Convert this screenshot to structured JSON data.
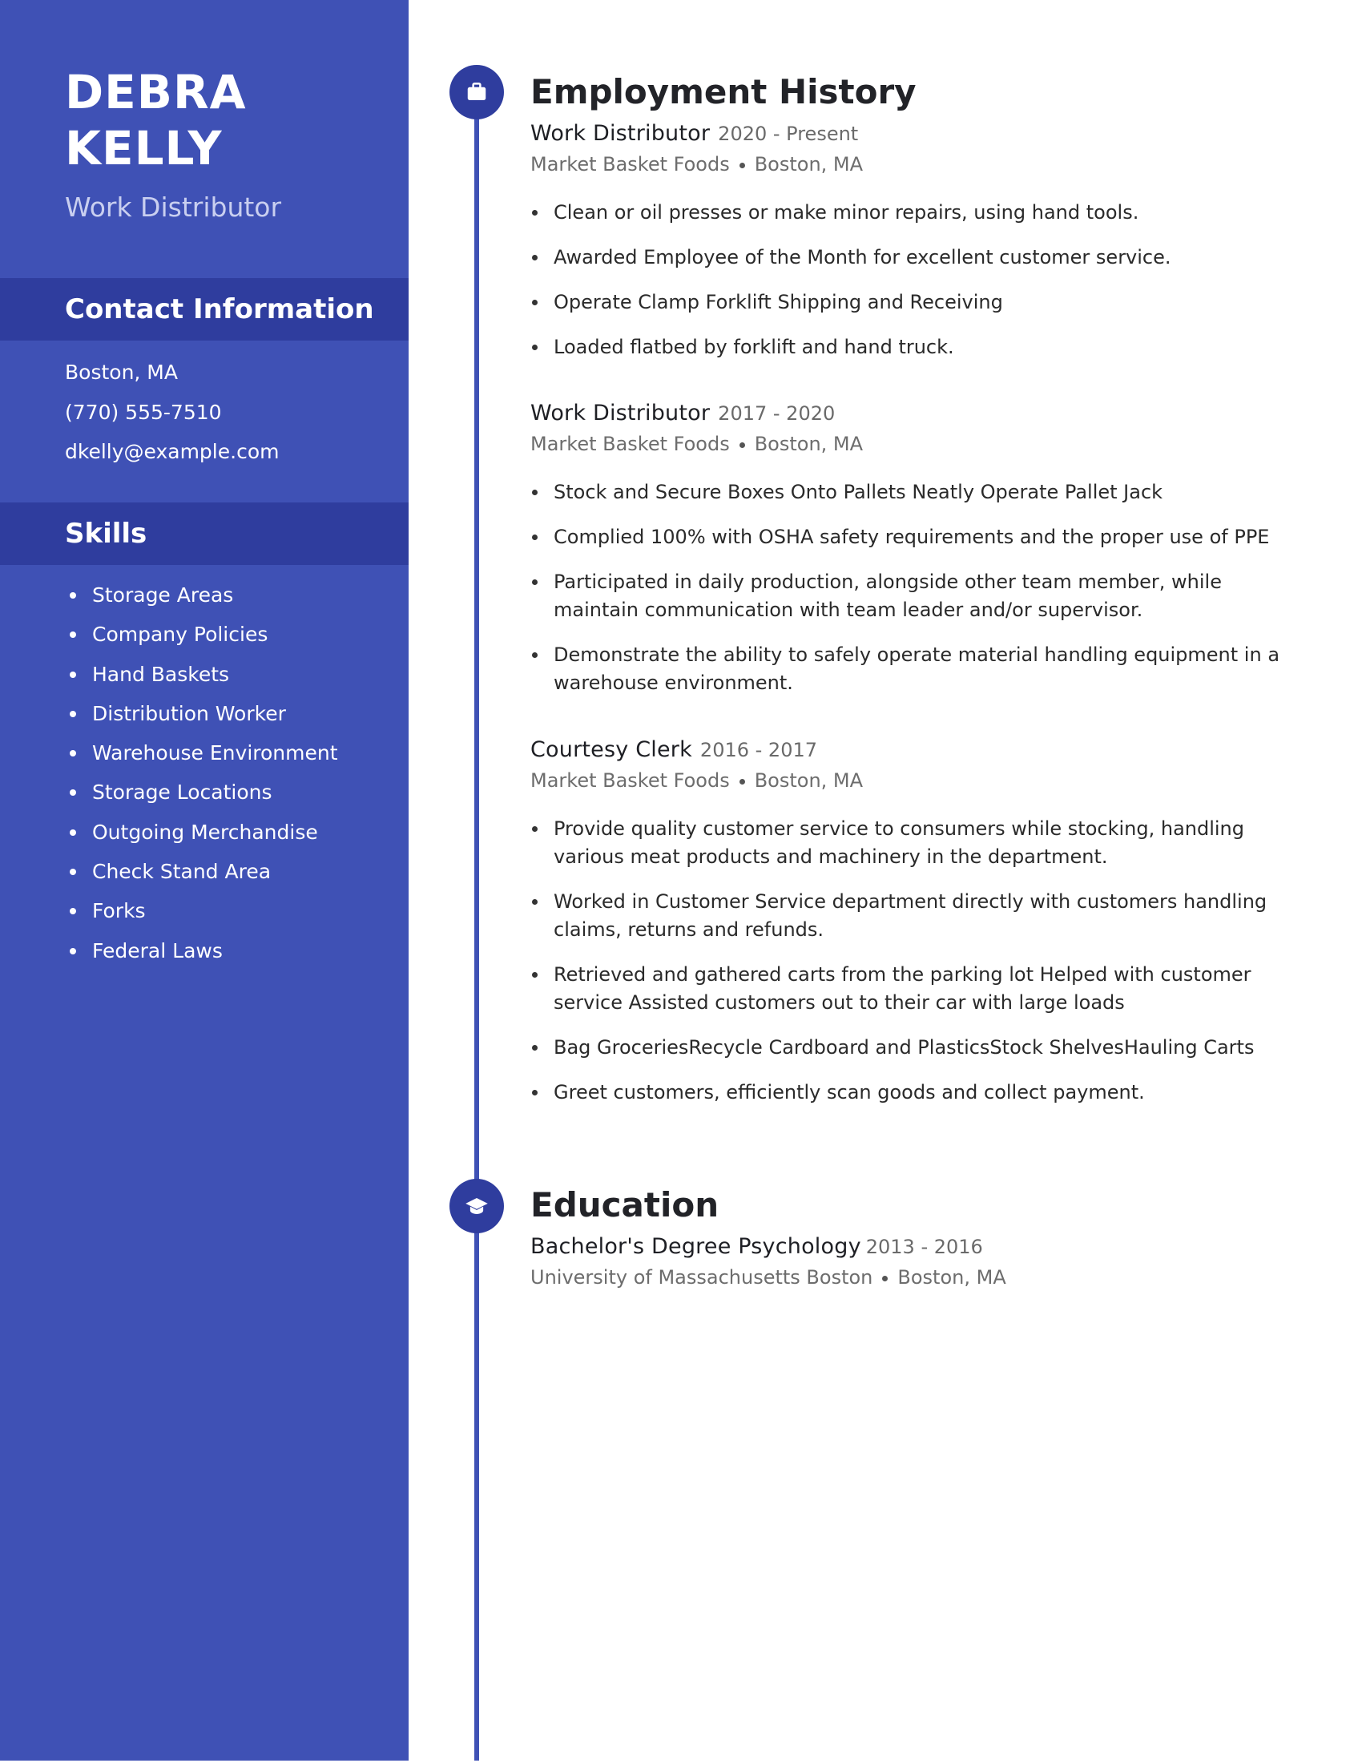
{
  "colors": {
    "sidebar": "#3f51b5",
    "sidebar_band": "#2f3d9e",
    "timeline_line": "#3f51b5",
    "timeline_node": "#2f3d9e",
    "heading_text": "#222328",
    "muted_text": "#6d6d6d"
  },
  "profile": {
    "first_name": "DEBRA",
    "last_name": "KELLY",
    "title": "Work Distributor"
  },
  "contact": {
    "heading": "Contact Information",
    "items": [
      "Boston, MA",
      "(770) 555-7510",
      "dkelly@example.com"
    ]
  },
  "skills": {
    "heading": "Skills",
    "items": [
      "Storage Areas",
      "Company Policies",
      "Hand Baskets",
      "Distribution Worker",
      "Warehouse Environment",
      "Storage Locations",
      "Outgoing Merchandise",
      "Check Stand Area",
      "Forks",
      "Federal Laws"
    ]
  },
  "employment": {
    "heading": "Employment History",
    "icon": "briefcase-icon",
    "jobs": [
      {
        "role": "Work Distributor",
        "dates": "2020 - Present",
        "company": "Market Basket Foods",
        "location": "Boston, MA",
        "bullets": [
          "Clean or oil presses or make minor repairs, using hand tools.",
          "Awarded Employee of the Month for excellent customer service.",
          "Operate Clamp Forklift Shipping and Receiving",
          "Loaded flatbed by forklift and hand truck."
        ]
      },
      {
        "role": "Work Distributor",
        "dates": "2017 - 2020",
        "company": "Market Basket Foods",
        "location": "Boston, MA",
        "bullets": [
          "Stock and Secure Boxes Onto Pallets Neatly Operate Pallet Jack",
          "Complied 100% with OSHA safety requirements and the proper use of PPE",
          "Participated in daily production, alongside other team member, while maintain communication with team leader and/or supervisor.",
          "Demonstrate the ability to safely operate material handling equipment in a warehouse environment."
        ]
      },
      {
        "role": "Courtesy Clerk",
        "dates": "2016 - 2017",
        "company": "Market Basket Foods",
        "location": "Boston, MA",
        "bullets": [
          "Provide quality customer service to consumers while stocking, handling various meat products and machinery in the department.",
          "Worked in Customer Service department directly with customers handling claims, returns and refunds.",
          "Retrieved and gathered carts from the parking lot Helped with customer service Assisted customers out to their car with large loads",
          "Bag GroceriesRecycle Cardboard and PlasticsStock ShelvesHauling Carts",
          "Greet customers, efficiently scan goods and collect payment."
        ]
      }
    ]
  },
  "education": {
    "heading": "Education",
    "icon": "graduation-cap-icon",
    "entries": [
      {
        "degree": "Bachelor's Degree Psychology",
        "dates": "2013 - 2016",
        "school": "University of Massachusetts Boston",
        "location": "Boston, MA"
      }
    ]
  }
}
